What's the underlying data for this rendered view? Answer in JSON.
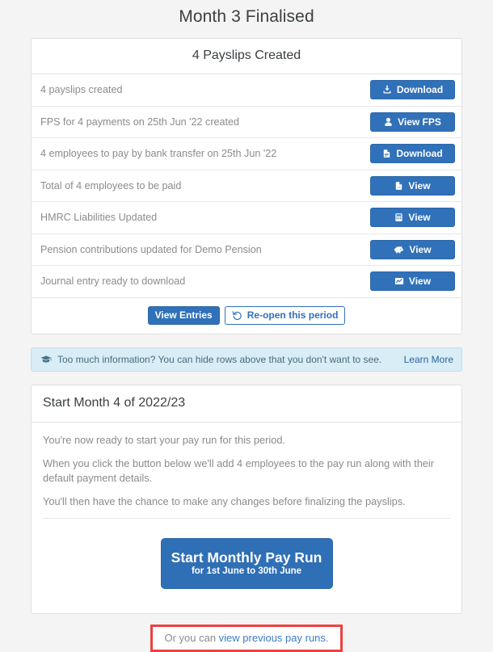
{
  "page": {
    "title": "Month 3 Finalised",
    "accent_color": "#3071b9",
    "background_color": "#f4f4f4"
  },
  "summary_panel": {
    "heading": "4 Payslips Created",
    "rows": [
      {
        "label": "4 payslips created",
        "icon": "download-icon",
        "button_label": "Download"
      },
      {
        "label": "FPS for 4 payments on 25th Jun '22 created",
        "icon": "user-icon",
        "button_label": "View FPS"
      },
      {
        "label": "4 employees to pay by bank transfer on 25th Jun '22",
        "icon": "file-icon",
        "button_label": "Download"
      },
      {
        "label": "Total of 4 employees to be paid",
        "icon": "pdf-file-icon",
        "button_label": "View"
      },
      {
        "label": "HMRC Liabilities Updated",
        "icon": "calculator-icon",
        "button_label": "View"
      },
      {
        "label": "Pension contributions updated for Demo Pension",
        "icon": "piggy-bank-icon",
        "button_label": "View"
      },
      {
        "label": "Journal entry ready to download",
        "icon": "chart-line-icon",
        "button_label": "View"
      }
    ],
    "footer": {
      "view_entries_label": "View Entries",
      "reopen_label": "Re-open this period",
      "reopen_icon": "undo-icon"
    }
  },
  "info_banner": {
    "icon": "graduation-cap-icon",
    "text": "Too much information? You can hide rows above that you don't want to see.",
    "link_label": "Learn More",
    "background_color": "#d9edf7"
  },
  "start_panel": {
    "heading": "Start Month 4 of 2022/23",
    "paragraphs": [
      "You're now ready to start your pay run for this period.",
      "When you click the button below we'll add 4 employees to the pay run along with their default payment details.",
      "You'll then have the chance to make any changes before finalizing the payslips."
    ],
    "cta": {
      "main_label": "Start Monthly Pay Run",
      "sub_label": "for 1st June to 30th June"
    }
  },
  "bottom_note": {
    "prefix": "Or you can ",
    "link_label": "view previous pay runs",
    "suffix": ".",
    "highlight_color": "#f04040"
  }
}
